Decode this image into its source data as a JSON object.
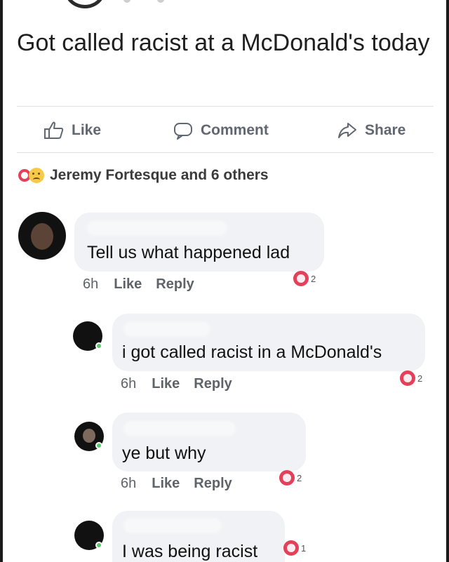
{
  "post": {
    "text": "Got called racist at a McDonald's today"
  },
  "actions": {
    "like": "Like",
    "comment": "Comment",
    "share": "Share"
  },
  "reactions": {
    "summary": "Jeremy Fortesque and 6 others"
  },
  "comments": [
    {
      "text": "Tell us what happened lad",
      "time": "6h",
      "like": "Like",
      "reply": "Reply",
      "reaction_count": "2"
    },
    {
      "text": "i got called racist in a McDonald's",
      "time": "6h",
      "like": "Like",
      "reply": "Reply",
      "reaction_count": "2"
    },
    {
      "text": "ye but why",
      "time": "6h",
      "like": "Like",
      "reply": "Reply",
      "reaction_count": "2"
    },
    {
      "text": "I was being racist",
      "reaction_count": "1"
    }
  ],
  "colors": {
    "reaction_red": "#e4405a",
    "bubble_gray": "#f0f2f5",
    "meta_gray": "#5f6368",
    "online_green": "#5ac86b"
  },
  "icons": {
    "like": "thumbs-up-icon",
    "comment": "speech-bubble-icon",
    "share": "share-arrow-icon"
  }
}
